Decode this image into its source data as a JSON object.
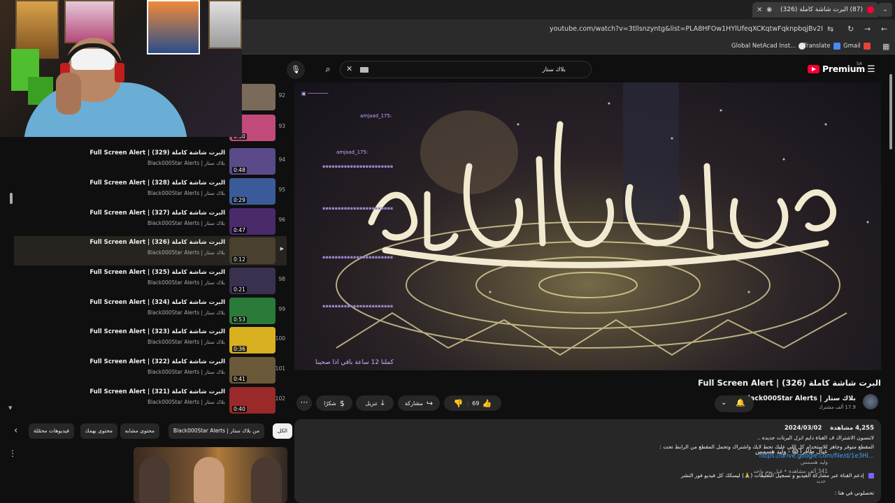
{
  "browser": {
    "tab_title": "(87) البرت شاشة كاملة (326)",
    "url": "youtube.com/watch?v=3tllsnzyntg&list=PLA8HFOw1HYlUfeqXCKqtwFqknpbqjBv2P&index=97",
    "new_tab": "+",
    "bookmarks": [
      "Global NetAcad Inst...",
      "Translate",
      "Gmail"
    ]
  },
  "header": {
    "logo_text": "Premium",
    "region": "SA",
    "search_query": "بلاك ستار"
  },
  "playlist": {
    "items": [
      {
        "num": "92",
        "title": "",
        "channel": "",
        "duration": "",
        "thumb": "#7a6a5a"
      },
      {
        "num": "93",
        "title": "",
        "channel": "",
        "duration": "0:30",
        "thumb": "#c04a7a"
      },
      {
        "num": "94",
        "title": "البرت شاشة كاملة (329) | Full Screen Alert",
        "channel": "بلاك ستار | Black000Star Alerts",
        "duration": "0:48",
        "thumb": "#5a4a8a"
      },
      {
        "num": "95",
        "title": "البرت شاشة كاملة (328) | Full Screen Alert",
        "channel": "بلاك ستار | Black000Star Alerts",
        "duration": "0:29",
        "thumb": "#3a5a9a"
      },
      {
        "num": "96",
        "title": "البرت شاشة كاملة (327) | Full Screen Alert",
        "channel": "بلاك ستار | Black000Star Alerts",
        "duration": "0:47",
        "thumb": "#4a2a6a"
      },
      {
        "num": "▶",
        "title": "البرت شاشة كاملة (326) | Full Screen Alert",
        "channel": "بلاك ستار | Black000Star Alerts",
        "duration": "0:12",
        "thumb": "#4a4030",
        "active": true
      },
      {
        "num": "98",
        "title": "البرت شاشة كاملة (325) | Full Screen Alert",
        "channel": "بلاك ستار | Black000Star Alerts",
        "duration": "0:21",
        "thumb": "#3a3050"
      },
      {
        "num": "99",
        "title": "البرت شاشة كاملة (324) | Full Screen Alert",
        "channel": "بلاك ستار | Black000Star Alerts",
        "duration": "0:53",
        "thumb": "#2a7a3a"
      },
      {
        "num": "100",
        "title": "البرت شاشة كاملة (323) | Full Screen Alert",
        "channel": "بلاك ستار | Black000Star Alerts",
        "duration": "0:36",
        "thumb": "#d8b020"
      },
      {
        "num": "101",
        "title": "البرت شاشة كاملة (322) | Full Screen Alert",
        "channel": "بلاك ستار | Black000Star Alerts",
        "duration": "0:41",
        "thumb": "#6a5a3a"
      },
      {
        "num": "102",
        "title": "البرت شاشة كاملة (321) | Full Screen Alert",
        "channel": "بلاك ستار | Black000Star Alerts",
        "duration": "0:40",
        "thumb": "#9a2a2a"
      }
    ]
  },
  "chips": [
    "الكل",
    "من بلاك ستار | Black000Star Alerts",
    "محتوى مشابه",
    "محتوى يهمك",
    "فيديوهات محمّلة"
  ],
  "recommended": {
    "title": "عيال طافرا 😱 - وليد هسمس",
    "channel": "وليد هسمس",
    "meta": "341 ألف مشاهدة • قبل يوم واحد",
    "badge": "جديد"
  },
  "video": {
    "title": "البرت شاشة كاملة (326) | Full Screen Alert",
    "channel_name": "بلاك ستار | Black000Star Alerts",
    "subscribers": "17.9 ألف مشترك",
    "likes": "69",
    "share": "مشاركة",
    "download": "تنزيل",
    "thanks": "شكرًا",
    "chat_user": "amjaad_175:",
    "chat_bottom": "كملنا 12 ساعة باقي اذا صحينا"
  },
  "description": {
    "views": "4,255 مشاهدة",
    "date": "2024/03/02",
    "lines": [
      "لاتنسون الاشتراك ف القناة دايم انزل البرتات جديده ..",
      "المقطع متوفر وجاهز للاستخدام كل اللي عليك تحط لايك واشتراك وتحمل المقطع من الرابط تحت :"
    ],
    "link": "https://drive.google.com/file/d/1e3HI...",
    "support": "إدعم القناة عبر مشاركة الفيديو و تسجيل التعليقات (🙏) ليسكك كل فيديو فور النشر",
    "contact": "تحصلوني في هنا :"
  }
}
